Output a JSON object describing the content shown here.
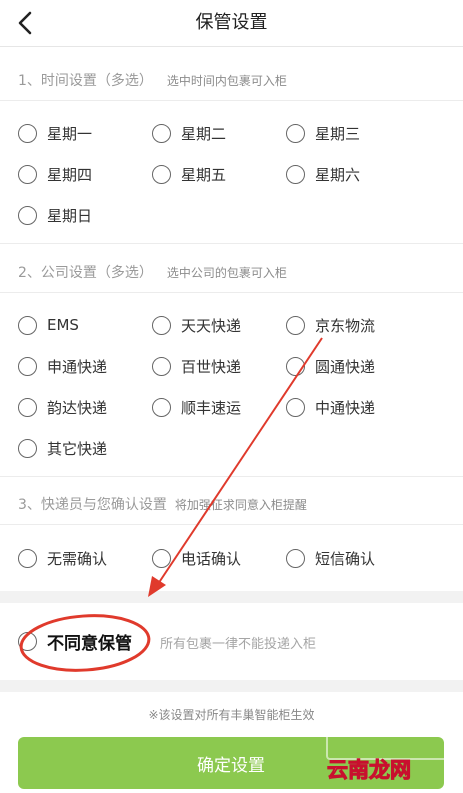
{
  "header": {
    "title": "保管设置",
    "back_icon": "chevron-left-icon"
  },
  "time_section": {
    "title": "1、时间设置（多选）",
    "hint": "选中时间内包裹可入柜",
    "options": [
      "星期一",
      "星期二",
      "星期三",
      "星期四",
      "星期五",
      "星期六",
      "星期日"
    ]
  },
  "company_section": {
    "title": "2、公司设置（多选）",
    "hint": "选中公司的包裹可入柜",
    "options": [
      "EMS",
      "天天快递",
      "京东物流",
      "申通快递",
      "百世快递",
      "圆通快递",
      "韵达快递",
      "顺丰速运",
      "中通快递",
      "其它快递"
    ]
  },
  "confirm_section": {
    "title": "3、快递员与您确认设置",
    "hint": "将加强征求同意入柜提醒",
    "options": [
      "无需确认",
      "电话确认",
      "短信确认"
    ]
  },
  "refuse": {
    "label": "不同意保管",
    "hint": "所有包裹一律不能投递入柜"
  },
  "footer": {
    "note": "※该设置对所有丰巢智能柜生效",
    "button": "确定设置"
  },
  "watermark": {
    "text": "云南龙网"
  },
  "colors": {
    "button": "#8cc94f",
    "annotation": "#e03a2c",
    "band": "#f2f2f2"
  }
}
